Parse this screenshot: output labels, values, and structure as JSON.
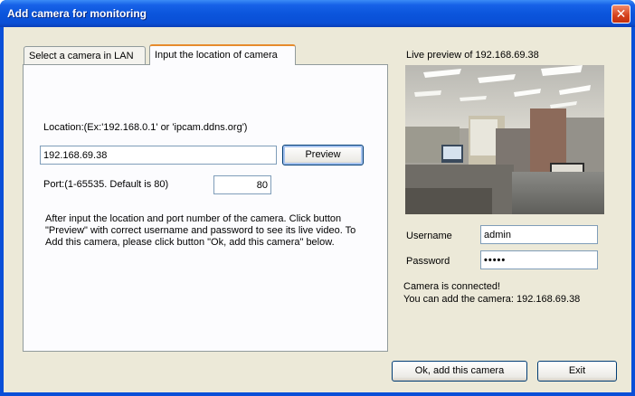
{
  "window": {
    "title": "Add camera for monitoring",
    "close_glyph": "✕"
  },
  "tabs": [
    {
      "label": "Select a camera in LAN",
      "active": false
    },
    {
      "label": "Input the location of camera",
      "active": true
    }
  ],
  "location": {
    "label": "Location:(Ex:'192.168.0.1' or 'ipcam.ddns.org')",
    "value": "192.168.69.38",
    "preview_button": "Preview"
  },
  "port": {
    "label": "Port:(1-65535. Default is 80)",
    "value": "80"
  },
  "instructions": "After input the location and port number of the camera. Click button \"Preview\" with correct username and password to see its live video. To Add this camera, please click button \"Ok, add this camera\" below.",
  "preview": {
    "label": "Live preview of 192.168.69.38"
  },
  "credentials": {
    "username_label": "Username",
    "username_value": "admin",
    "password_label": "Password",
    "password_value": "•••••"
  },
  "status": {
    "line1": "Camera is connected!",
    "line2": "You can add the camera: 192.168.69.38"
  },
  "buttons": {
    "ok": "Ok, add this camera",
    "exit": "Exit"
  },
  "colors": {
    "titlebar": "#0a4fd8",
    "client_bg": "#ece9d8",
    "close_button": "#d4401c"
  }
}
